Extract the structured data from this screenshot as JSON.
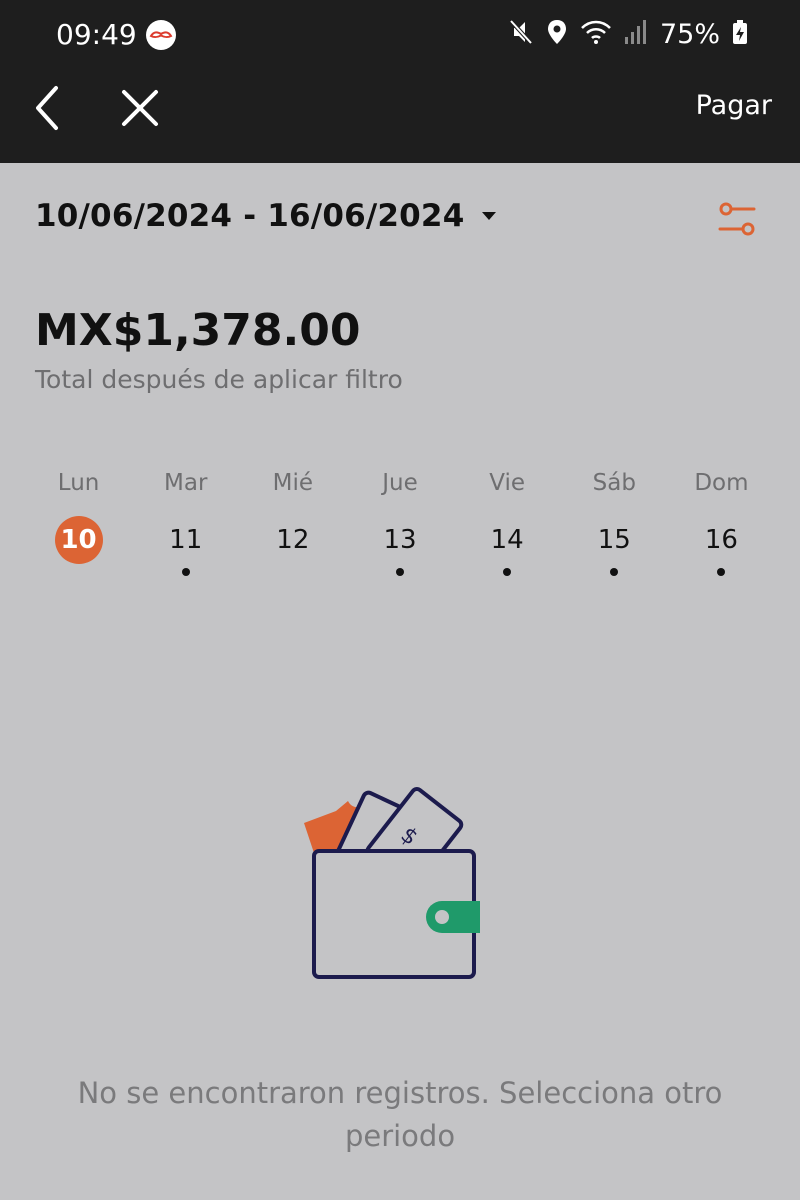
{
  "status_bar": {
    "time": "09:49",
    "battery": "75%",
    "icons": [
      "mustache-app-icon",
      "mute-icon",
      "location-icon",
      "wifi-icon",
      "signal-icon",
      "battery-charging-icon"
    ]
  },
  "nav": {
    "back_icon": "chevron-left-icon",
    "close_icon": "close-icon",
    "pay_label": "Pagar"
  },
  "date_range": {
    "label": "10/06/2024 - 16/06/2024",
    "dropdown_icon": "caret-down-icon",
    "filter_icon": "filter-sliders-icon"
  },
  "summary": {
    "total": "MX$1,378.00",
    "caption": "Total después de aplicar filtro"
  },
  "week": {
    "days": [
      {
        "name": "Lun",
        "number": "10",
        "selected": true,
        "has_records": false
      },
      {
        "name": "Mar",
        "number": "11",
        "selected": false,
        "has_records": true
      },
      {
        "name": "Mié",
        "number": "12",
        "selected": false,
        "has_records": false
      },
      {
        "name": "Jue",
        "number": "13",
        "selected": false,
        "has_records": true
      },
      {
        "name": "Vie",
        "number": "14",
        "selected": false,
        "has_records": true
      },
      {
        "name": "Sáb",
        "number": "15",
        "selected": false,
        "has_records": true
      },
      {
        "name": "Dom",
        "number": "16",
        "selected": false,
        "has_records": true
      }
    ]
  },
  "empty_state": {
    "illustration": "wallet-icon",
    "message": "No se encontraron registros. Selecciona otro periodo"
  },
  "colors": {
    "accent": "#dc6434",
    "wallet_clasp": "#1f9a6a",
    "illustration_line": "#1c1b4d",
    "header_bg": "#1e1e1e",
    "page_bg": "#c4c4c6"
  }
}
